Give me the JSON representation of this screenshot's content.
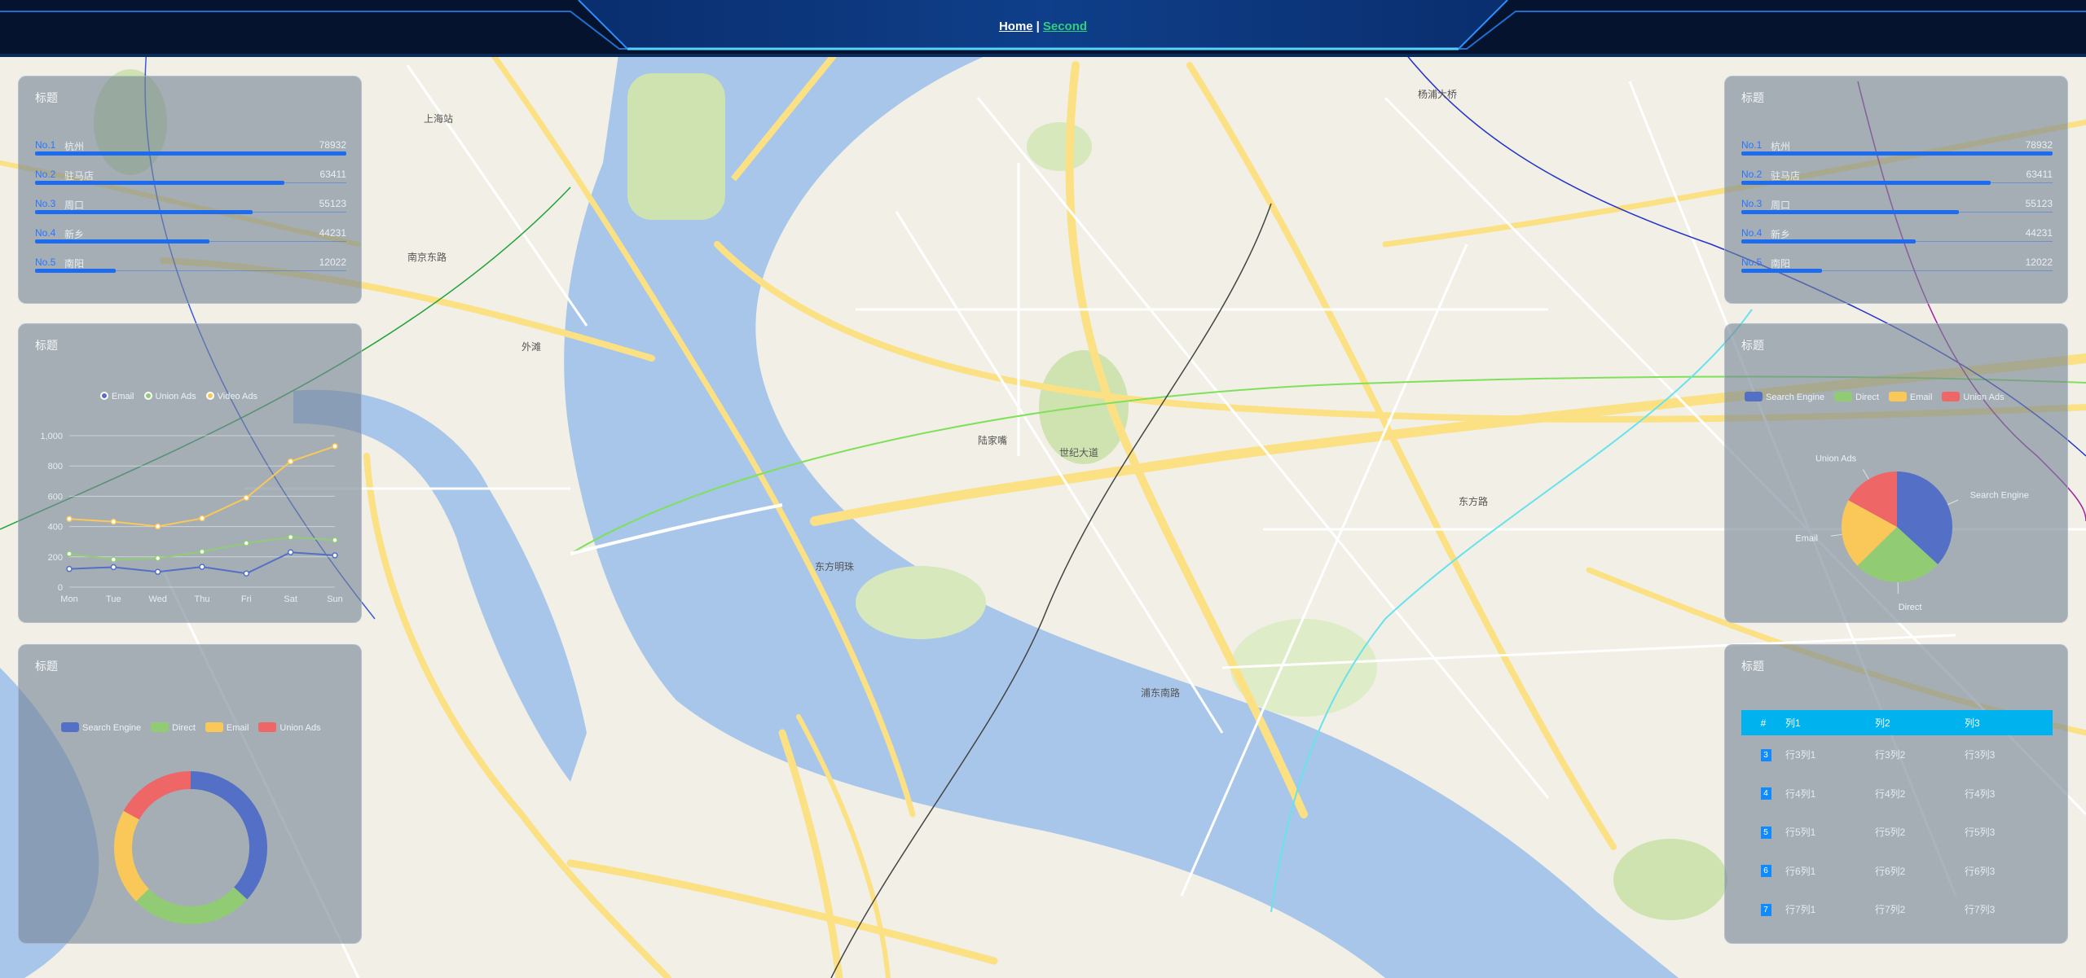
{
  "nav": {
    "home": "Home",
    "separator": "|",
    "second": "Second"
  },
  "colors": {
    "accent": "#1d6cf0",
    "table_header": "#00b3ee",
    "water": "#a8c6ea",
    "road": "#fbe183"
  },
  "left_top": {
    "title": "标题",
    "items": [
      {
        "no": "No.1",
        "name": "杭州",
        "value": "78932",
        "ratio": 1.0
      },
      {
        "no": "No.2",
        "name": "驻马店",
        "value": "63411",
        "ratio": 0.8
      },
      {
        "no": "No.3",
        "name": "周口",
        "value": "55123",
        "ratio": 0.7
      },
      {
        "no": "No.4",
        "name": "新乡",
        "value": "44231",
        "ratio": 0.56
      },
      {
        "no": "No.5",
        "name": "南阳",
        "value": "12022",
        "ratio": 0.26
      }
    ]
  },
  "left_mid": {
    "title": "标题",
    "chart_data": {
      "type": "line",
      "categories": [
        "Mon",
        "Tue",
        "Wed",
        "Thu",
        "Fri",
        "Sat",
        "Sun"
      ],
      "y_ticks": [
        "0",
        "200",
        "400",
        "600",
        "800",
        "1,000"
      ],
      "ylim": [
        0,
        1000
      ],
      "series": [
        {
          "name": "Email",
          "color": "#5470c6",
          "values": [
            120,
            132,
            101,
            134,
            90,
            230,
            210
          ]
        },
        {
          "name": "Union Ads",
          "color": "#91cc75",
          "values": [
            220,
            182,
            191,
            234,
            290,
            330,
            310
          ]
        },
        {
          "name": "Video Ads",
          "color": "#fac858",
          "values": [
            450,
            432,
            401,
            454,
            590,
            830,
            930
          ]
        }
      ],
      "legend": "top-center",
      "grid": true
    }
  },
  "left_bottom": {
    "title": "标题",
    "chart_data": {
      "type": "pie",
      "donut": true,
      "series": [
        {
          "name": "Search Engine",
          "color": "#5470c6",
          "value": 1048
        },
        {
          "name": "Direct",
          "color": "#91cc75",
          "value": 735
        },
        {
          "name": "Email",
          "color": "#fac858",
          "value": 580
        },
        {
          "name": "Union Ads",
          "color": "#ee6666",
          "value": 484
        }
      ],
      "legend": "top"
    }
  },
  "right_top": {
    "title": "标题",
    "items": [
      {
        "no": "No.1",
        "name": "杭州",
        "value": "78932",
        "ratio": 1.0
      },
      {
        "no": "No.2",
        "name": "驻马店",
        "value": "63411",
        "ratio": 0.8
      },
      {
        "no": "No.3",
        "name": "周口",
        "value": "55123",
        "ratio": 0.7
      },
      {
        "no": "No.4",
        "name": "新乡",
        "value": "44231",
        "ratio": 0.56
      },
      {
        "no": "No.5",
        "name": "南阳",
        "value": "12022",
        "ratio": 0.26
      }
    ]
  },
  "right_mid": {
    "title": "标题",
    "chart_data": {
      "type": "pie",
      "donut": false,
      "series": [
        {
          "name": "Search Engine",
          "color": "#5470c6",
          "value": 1048
        },
        {
          "name": "Direct",
          "color": "#91cc75",
          "value": 735
        },
        {
          "name": "Email",
          "color": "#fac858",
          "value": 580
        },
        {
          "name": "Union Ads",
          "color": "#ee6666",
          "value": 484
        }
      ],
      "legend": "top"
    }
  },
  "right_bottom": {
    "title": "标题",
    "columns": [
      "#",
      "列1",
      "列2",
      "列3"
    ],
    "rows": [
      [
        "3",
        "行3列1",
        "行3列2",
        "行3列3"
      ],
      [
        "4",
        "行4列1",
        "行4列2",
        "行4列3"
      ],
      [
        "5",
        "行5列1",
        "行5列2",
        "行5列3"
      ],
      [
        "6",
        "行6列1",
        "行6列2",
        "行6列3"
      ],
      [
        "7",
        "行7列1",
        "行7列2",
        "行7列3"
      ]
    ]
  },
  "map": {
    "labels": [
      "陆家嘴",
      "世纪大道",
      "东方明珠",
      "浦东南路",
      "南京东路",
      "外滩",
      "上海站",
      "东方路",
      "杨浦大桥"
    ]
  }
}
